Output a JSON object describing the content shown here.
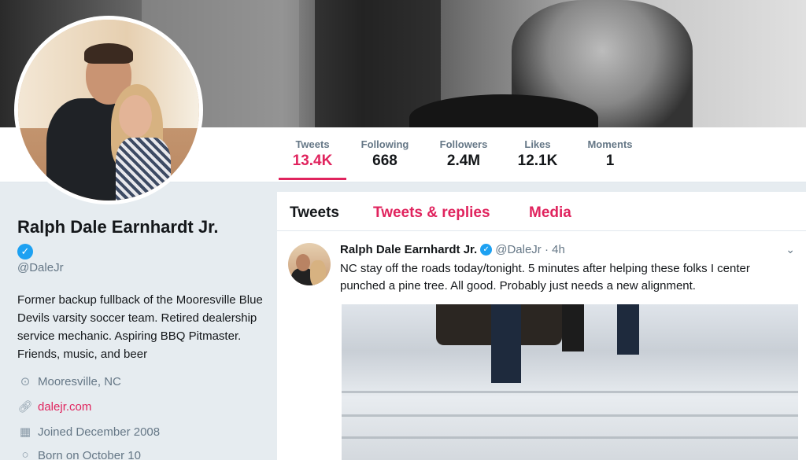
{
  "profile": {
    "name": "Ralph Dale Earnhardt Jr.",
    "handle": "@DaleJr",
    "bio": "Former backup fullback of the Mooresville Blue Devils varsity soccer team. Retired dealership service mechanic. Aspiring BBQ Pitmaster. Friends, music, and beer",
    "location": "Mooresville, NC",
    "website": "dalejr.com",
    "joined": "Joined December 2008",
    "born": "Born on October 10"
  },
  "stats": [
    {
      "label": "Tweets",
      "value": "13.4K"
    },
    {
      "label": "Following",
      "value": "668"
    },
    {
      "label": "Followers",
      "value": "2.4M"
    },
    {
      "label": "Likes",
      "value": "12.1K"
    },
    {
      "label": "Moments",
      "value": "1"
    }
  ],
  "tabs": [
    {
      "label": "Tweets"
    },
    {
      "label": "Tweets & replies"
    },
    {
      "label": "Media"
    }
  ],
  "tweet": {
    "author": "Ralph Dale Earnhardt Jr.",
    "handle_time": "@DaleJr · 4h",
    "text": "NC stay off the roads today/tonight. 5 minutes after helping these folks I center punched a pine tree. All good. Probably just needs a new alignment."
  },
  "icons": {
    "verified": "verified-badge-icon",
    "location": "location-pin-icon",
    "link": "link-icon",
    "calendar": "calendar-icon",
    "balloon": "birthday-balloon-icon",
    "chevron": "chevron-down-icon"
  },
  "colors": {
    "accent": "#e0245e",
    "verified": "#1da1f2"
  }
}
